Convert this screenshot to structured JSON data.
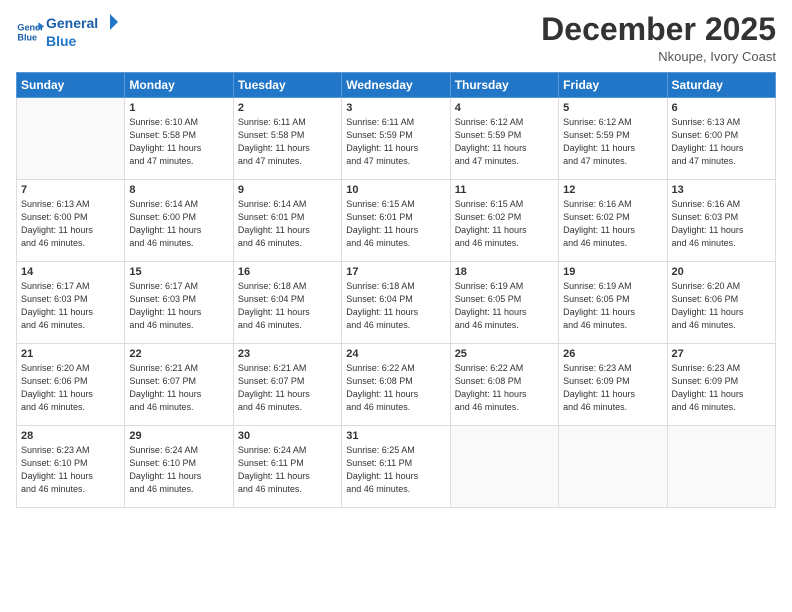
{
  "logo": {
    "line1": "General",
    "line2": "Blue"
  },
  "title": "December 2025",
  "location": "Nkoupe, Ivory Coast",
  "days_of_week": [
    "Sunday",
    "Monday",
    "Tuesday",
    "Wednesday",
    "Thursday",
    "Friday",
    "Saturday"
  ],
  "weeks": [
    [
      {
        "day": "",
        "info": ""
      },
      {
        "day": "1",
        "info": "Sunrise: 6:10 AM\nSunset: 5:58 PM\nDaylight: 11 hours\nand 47 minutes."
      },
      {
        "day": "2",
        "info": "Sunrise: 6:11 AM\nSunset: 5:58 PM\nDaylight: 11 hours\nand 47 minutes."
      },
      {
        "day": "3",
        "info": "Sunrise: 6:11 AM\nSunset: 5:59 PM\nDaylight: 11 hours\nand 47 minutes."
      },
      {
        "day": "4",
        "info": "Sunrise: 6:12 AM\nSunset: 5:59 PM\nDaylight: 11 hours\nand 47 minutes."
      },
      {
        "day": "5",
        "info": "Sunrise: 6:12 AM\nSunset: 5:59 PM\nDaylight: 11 hours\nand 47 minutes."
      },
      {
        "day": "6",
        "info": "Sunrise: 6:13 AM\nSunset: 6:00 PM\nDaylight: 11 hours\nand 47 minutes."
      }
    ],
    [
      {
        "day": "7",
        "info": "Sunrise: 6:13 AM\nSunset: 6:00 PM\nDaylight: 11 hours\nand 46 minutes."
      },
      {
        "day": "8",
        "info": "Sunrise: 6:14 AM\nSunset: 6:00 PM\nDaylight: 11 hours\nand 46 minutes."
      },
      {
        "day": "9",
        "info": "Sunrise: 6:14 AM\nSunset: 6:01 PM\nDaylight: 11 hours\nand 46 minutes."
      },
      {
        "day": "10",
        "info": "Sunrise: 6:15 AM\nSunset: 6:01 PM\nDaylight: 11 hours\nand 46 minutes."
      },
      {
        "day": "11",
        "info": "Sunrise: 6:15 AM\nSunset: 6:02 PM\nDaylight: 11 hours\nand 46 minutes."
      },
      {
        "day": "12",
        "info": "Sunrise: 6:16 AM\nSunset: 6:02 PM\nDaylight: 11 hours\nand 46 minutes."
      },
      {
        "day": "13",
        "info": "Sunrise: 6:16 AM\nSunset: 6:03 PM\nDaylight: 11 hours\nand 46 minutes."
      }
    ],
    [
      {
        "day": "14",
        "info": "Sunrise: 6:17 AM\nSunset: 6:03 PM\nDaylight: 11 hours\nand 46 minutes."
      },
      {
        "day": "15",
        "info": "Sunrise: 6:17 AM\nSunset: 6:03 PM\nDaylight: 11 hours\nand 46 minutes."
      },
      {
        "day": "16",
        "info": "Sunrise: 6:18 AM\nSunset: 6:04 PM\nDaylight: 11 hours\nand 46 minutes."
      },
      {
        "day": "17",
        "info": "Sunrise: 6:18 AM\nSunset: 6:04 PM\nDaylight: 11 hours\nand 46 minutes."
      },
      {
        "day": "18",
        "info": "Sunrise: 6:19 AM\nSunset: 6:05 PM\nDaylight: 11 hours\nand 46 minutes."
      },
      {
        "day": "19",
        "info": "Sunrise: 6:19 AM\nSunset: 6:05 PM\nDaylight: 11 hours\nand 46 minutes."
      },
      {
        "day": "20",
        "info": "Sunrise: 6:20 AM\nSunset: 6:06 PM\nDaylight: 11 hours\nand 46 minutes."
      }
    ],
    [
      {
        "day": "21",
        "info": "Sunrise: 6:20 AM\nSunset: 6:06 PM\nDaylight: 11 hours\nand 46 minutes."
      },
      {
        "day": "22",
        "info": "Sunrise: 6:21 AM\nSunset: 6:07 PM\nDaylight: 11 hours\nand 46 minutes."
      },
      {
        "day": "23",
        "info": "Sunrise: 6:21 AM\nSunset: 6:07 PM\nDaylight: 11 hours\nand 46 minutes."
      },
      {
        "day": "24",
        "info": "Sunrise: 6:22 AM\nSunset: 6:08 PM\nDaylight: 11 hours\nand 46 minutes."
      },
      {
        "day": "25",
        "info": "Sunrise: 6:22 AM\nSunset: 6:08 PM\nDaylight: 11 hours\nand 46 minutes."
      },
      {
        "day": "26",
        "info": "Sunrise: 6:23 AM\nSunset: 6:09 PM\nDaylight: 11 hours\nand 46 minutes."
      },
      {
        "day": "27",
        "info": "Sunrise: 6:23 AM\nSunset: 6:09 PM\nDaylight: 11 hours\nand 46 minutes."
      }
    ],
    [
      {
        "day": "28",
        "info": "Sunrise: 6:23 AM\nSunset: 6:10 PM\nDaylight: 11 hours\nand 46 minutes."
      },
      {
        "day": "29",
        "info": "Sunrise: 6:24 AM\nSunset: 6:10 PM\nDaylight: 11 hours\nand 46 minutes."
      },
      {
        "day": "30",
        "info": "Sunrise: 6:24 AM\nSunset: 6:11 PM\nDaylight: 11 hours\nand 46 minutes."
      },
      {
        "day": "31",
        "info": "Sunrise: 6:25 AM\nSunset: 6:11 PM\nDaylight: 11 hours\nand 46 minutes."
      },
      {
        "day": "",
        "info": ""
      },
      {
        "day": "",
        "info": ""
      },
      {
        "day": "",
        "info": ""
      }
    ]
  ]
}
